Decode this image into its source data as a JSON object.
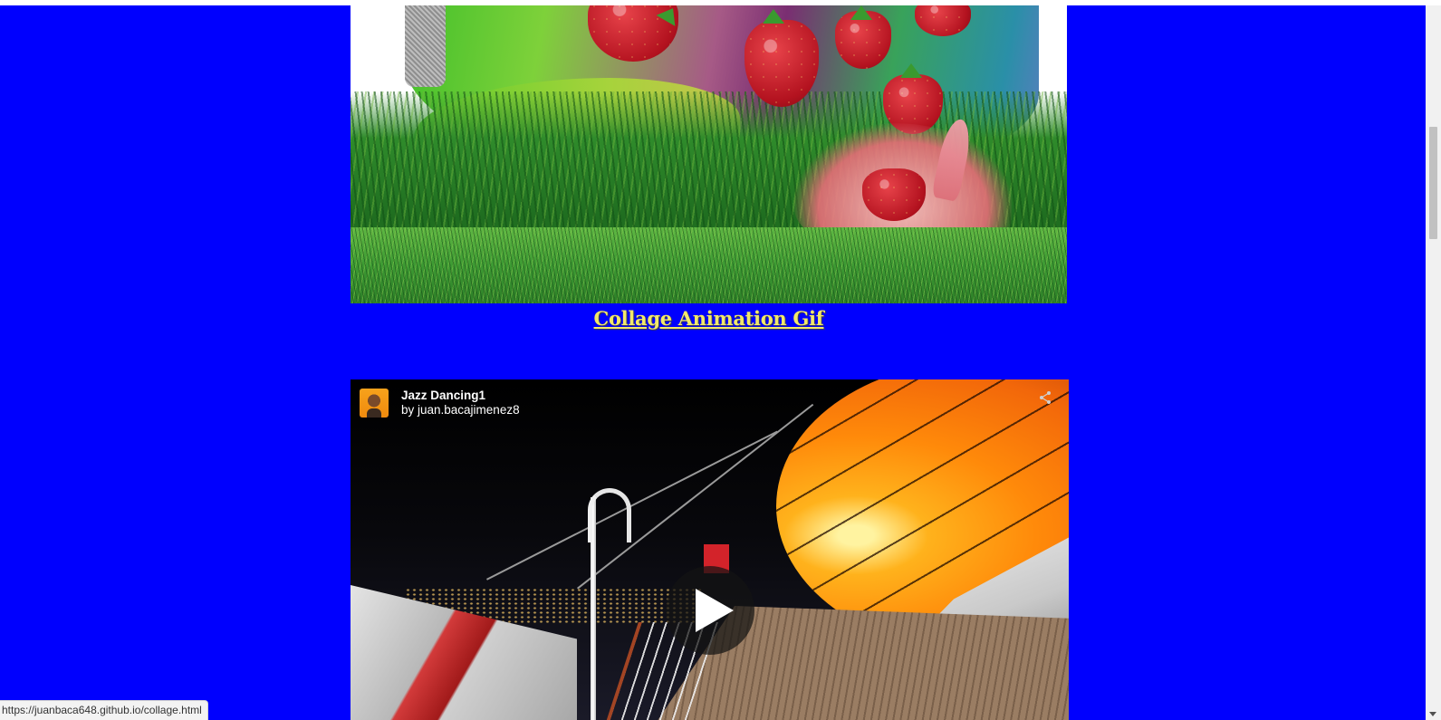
{
  "collage": {
    "caption": "Collage Animation Gif",
    "caption_color": "#f2e86a"
  },
  "video": {
    "title": "Jazz Dancing1",
    "author": "by juan.bacajimenez8",
    "icons": [
      "avatar",
      "share-icon",
      "play-icon"
    ]
  },
  "status_bar": {
    "url": "https://juanbaca648.github.io/collage.html"
  },
  "colors": {
    "page_background": "#0000fe"
  }
}
